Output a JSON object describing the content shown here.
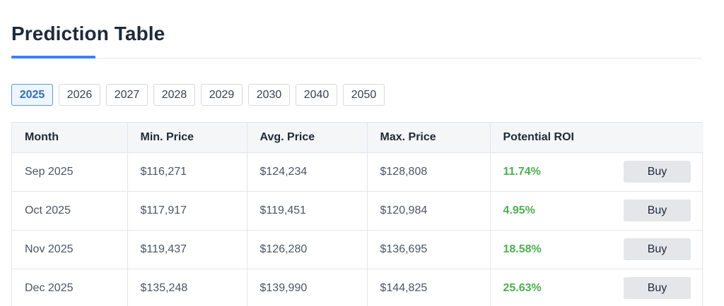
{
  "title": "Prediction Table",
  "years": [
    "2025",
    "2026",
    "2027",
    "2028",
    "2029",
    "2030",
    "2040",
    "2050"
  ],
  "selected_year": "2025",
  "table": {
    "headers": [
      "Month",
      "Min. Price",
      "Avg. Price",
      "Max. Price",
      "Potential ROI"
    ],
    "rows": [
      {
        "month": "Sep 2025",
        "min": "$116,271",
        "avg": "$124,234",
        "max": "$128,808",
        "roi": "11.74%",
        "action": "Buy"
      },
      {
        "month": "Oct 2025",
        "min": "$117,917",
        "avg": "$119,451",
        "max": "$120,984",
        "roi": "4.95%",
        "action": "Buy"
      },
      {
        "month": "Nov 2025",
        "min": "$119,437",
        "avg": "$126,280",
        "max": "$136,695",
        "roi": "18.58%",
        "action": "Buy"
      },
      {
        "month": "Dec 2025",
        "min": "$135,248",
        "avg": "$139,990",
        "max": "$144,825",
        "roi": "25.63%",
        "action": "Buy"
      }
    ]
  },
  "colors": {
    "accent": "#3b82f6",
    "roi_positive": "#4caf50"
  }
}
